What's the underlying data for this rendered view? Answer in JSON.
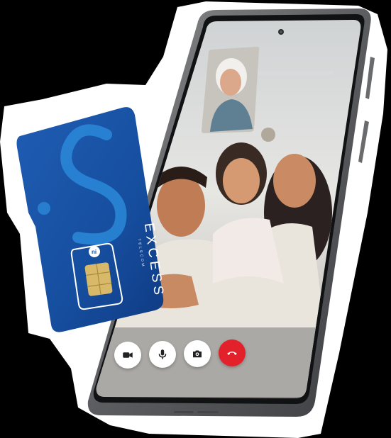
{
  "brand": {
    "name": "EXCESS",
    "subtitle": "TELECOM",
    "chip_logo": "ni"
  },
  "colors": {
    "sim_blue": "#1a4fa0",
    "sim_blue_dark": "#0f3a82",
    "sim_swirl": "#2a88d8",
    "phone_frame": "#6d6e70",
    "end_call_red": "#e3212b",
    "chip_gold": "#d8b96a"
  },
  "call_controls": [
    {
      "icon": "video-camera-icon"
    },
    {
      "icon": "microphone-icon"
    },
    {
      "icon": "switch-camera-icon"
    },
    {
      "icon": "end-call-icon"
    }
  ]
}
